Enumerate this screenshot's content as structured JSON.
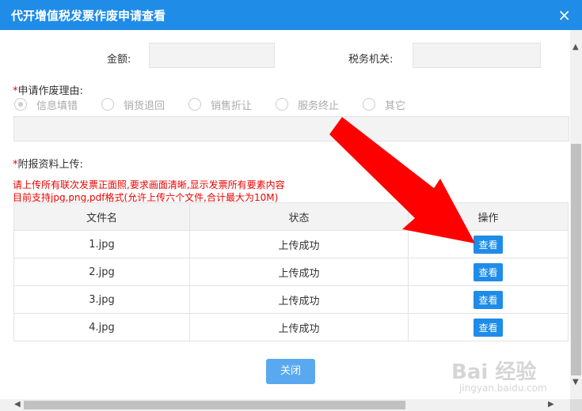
{
  "dialog": {
    "title": "代开增值税发票作废申请查看",
    "close_icon": "×"
  },
  "fields": {
    "amount_label": "金额:",
    "tax_office_label": "税务机关:"
  },
  "reason": {
    "label": "申请作废理由:",
    "required_mark": "*",
    "options": [
      "信息填错",
      "销货退回",
      "销售折让",
      "服务终止",
      "其它"
    ],
    "selected": 0
  },
  "attachments": {
    "label": "附报资料上传:",
    "required_mark": "*",
    "note_line1": "请上传所有联次发票正面照,要求画面清晰,显示发票所有要素内容",
    "note_line2": "目前支持jpg,png,pdf格式(允许上传六个文件,合计最大为10M)",
    "columns": [
      "文件名",
      "状态",
      "操作"
    ],
    "rows": [
      {
        "name": "1.jpg",
        "status": "上传成功",
        "action": "查看"
      },
      {
        "name": "2.jpg",
        "status": "上传成功",
        "action": "查看"
      },
      {
        "name": "3.jpg",
        "status": "上传成功",
        "action": "查看"
      },
      {
        "name": "4.jpg",
        "status": "上传成功",
        "action": "查看"
      }
    ]
  },
  "footer": {
    "close_button": "关闭"
  },
  "watermark": {
    "brand": "Bai 经验",
    "url": "jingyan.baidu.com"
  },
  "colors": {
    "accent": "#1f8ce8",
    "annotation_arrow": "#ff0000",
    "required": "#e00000"
  }
}
